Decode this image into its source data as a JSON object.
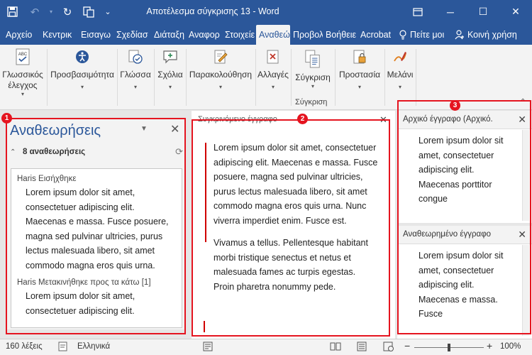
{
  "window": {
    "title": "Αποτέλεσμα σύγκρισης 13  -  Word",
    "controls": {
      "minimize": "─",
      "maximize": "☐",
      "close": "✕",
      "ribbon_display": "⧉"
    }
  },
  "quick_access": {
    "save": "🖫",
    "undo": "↶",
    "redo": "↻",
    "touch": "⊞",
    "customize": "≡"
  },
  "tabs": [
    {
      "label": "Αρχείο"
    },
    {
      "label": "Κεντρικ"
    },
    {
      "label": "Εισαγω"
    },
    {
      "label": "Σχεδίασ"
    },
    {
      "label": "Διάταξη"
    },
    {
      "label": "Αναφορ"
    },
    {
      "label": "Στοιχείε"
    },
    {
      "label": "Αναθεώ"
    },
    {
      "label": "Προβολ"
    },
    {
      "label": "Βοήθειε"
    },
    {
      "label": "Acrobat"
    }
  ],
  "help_box": {
    "label": "Πείτε μοι"
  },
  "share": {
    "label": "Κοινή χρήση"
  },
  "ribbon": {
    "groups": [
      {
        "line1": "Γλωσσικός",
        "line2": "έλεγχος"
      },
      {
        "line1": "Προσβασιμότητα",
        "line2": ""
      },
      {
        "line1": "Γλώσσα",
        "line2": ""
      },
      {
        "line1": "Σχόλια",
        "line2": ""
      },
      {
        "line1": "Παρακολούθηση",
        "line2": ""
      },
      {
        "line1": "Αλλαγές",
        "line2": ""
      },
      {
        "line1": "Σύγκριση",
        "line2": ""
      },
      {
        "line1": "Προστασία",
        "line2": ""
      },
      {
        "line1": "Μελάνι",
        "line2": ""
      }
    ],
    "compare_group_name": "Σύγκριση",
    "abc_text": "ABC"
  },
  "revisions_pane": {
    "title": "Αναθεωρήσεις",
    "close": "✕",
    "dropdown": "▼",
    "collapse": "⌃",
    "refresh": "⟳",
    "count_label": "8 αναθεωρήσεις",
    "items": [
      {
        "header": "Haris Εισήχθηκε",
        "body": "Lorem ipsum dolor sit amet, consectetuer adipiscing elit. Maecenas e massa. Fusce posuere, magna sed pulvinar ultricies, purus lectus malesuada libero, sit amet commodo magna eros quis urna."
      },
      {
        "header": "Haris Μετακινήθηκε προς τα κάτω [1]",
        "body": "Lorem ipsum dolor sit amet, consectetuer adipiscing elit."
      }
    ]
  },
  "combined_doc": {
    "label": "Συγκρινόμενο έγγραφο",
    "close": "✕",
    "paragraphs": [
      "Lorem ipsum dolor sit amet, consectetuer adipiscing elit. Maecenas e massa. Fusce posuere, magna sed pulvinar ultricies, purus lectus malesuada libero, sit amet commodo magna eros quis urna. Nunc viverra imperdiet enim. Fusce est.",
      "Vivamus a tellus. Pellentesque habitant morbi tristique senectus et netus et malesuada fames ac turpis egestas. Proin pharetra nonummy pede."
    ]
  },
  "original_doc": {
    "label": "Αρχικό έγγραφο (Αρχικό.",
    "close": "✕",
    "text": "Lorem ipsum dolor sit amet, consectetuer adipiscing elit. Maecenas porttitor congue"
  },
  "revised_doc": {
    "label": "Αναθεωρημένο έγγραφο",
    "close": "✕",
    "text": "Lorem ipsum dolor sit amet, consectetuer adipiscing elit. Maecenas e massa. Fusce"
  },
  "badges": [
    "1",
    "2",
    "3"
  ],
  "status_bar": {
    "words": "160 λέξεις",
    "language": "Ελληνικά",
    "zoom_minus": "−",
    "zoom_plus": "+",
    "zoom": "100%"
  }
}
